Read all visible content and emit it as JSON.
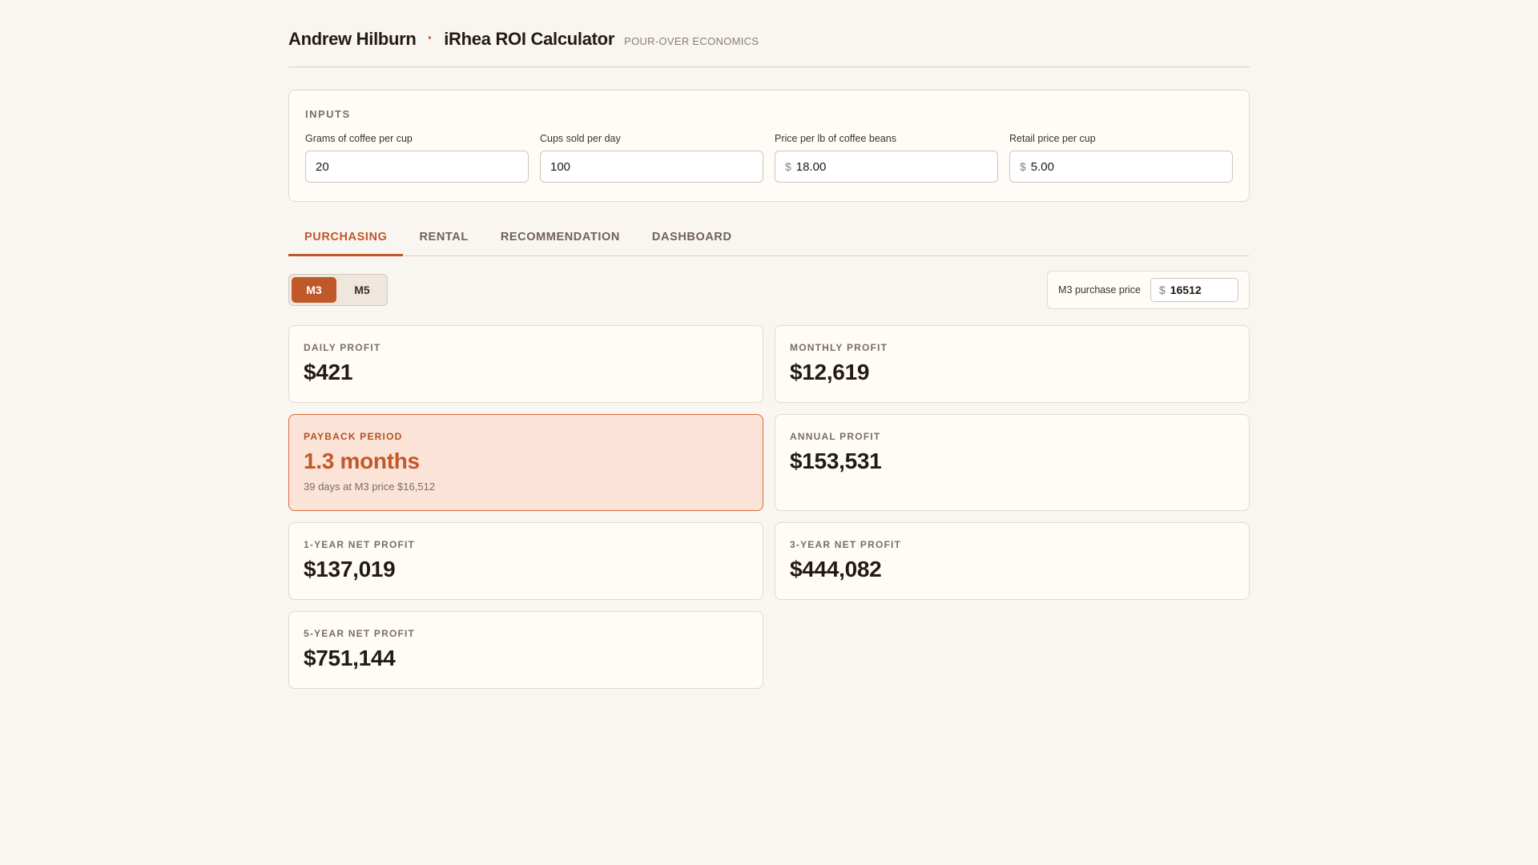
{
  "header": {
    "name": "Andrew Hilburn",
    "separator": "·",
    "title": "iRhea ROI Calculator",
    "tagline": "POUR-OVER ECONOMICS"
  },
  "inputs": {
    "section_label": "INPUTS",
    "fields": [
      {
        "label": "Grams of coffee per cup",
        "value": "20",
        "currency": ""
      },
      {
        "label": "Cups sold per day",
        "value": "100",
        "currency": ""
      },
      {
        "label": "Price per lb of coffee beans",
        "value": "18.00",
        "currency": "$"
      },
      {
        "label": "Retail price per cup",
        "value": "5.00",
        "currency": "$"
      }
    ]
  },
  "tabs": [
    {
      "label": "PURCHASING",
      "active": true
    },
    {
      "label": "RENTAL",
      "active": false
    },
    {
      "label": "RECOMMENDATION",
      "active": false
    },
    {
      "label": "DASHBOARD",
      "active": false
    }
  ],
  "model_toggle": {
    "options": [
      "M3",
      "M5"
    ],
    "selected": "M3"
  },
  "purchase_price": {
    "label": "M3 purchase price",
    "currency": "$",
    "value": "16512"
  },
  "cards": {
    "daily_profit": {
      "label": "DAILY PROFIT",
      "value": "$421"
    },
    "monthly_profit": {
      "label": "MONTHLY PROFIT",
      "value": "$12,619"
    },
    "payback_period": {
      "label": "PAYBACK PERIOD",
      "value": "1.3 months",
      "sub": "39 days at M3 price $16,512"
    },
    "annual_profit": {
      "label": "ANNUAL PROFIT",
      "value": "$153,531"
    },
    "net_1yr": {
      "label": "1-YEAR NET PROFIT",
      "value": "$137,019"
    },
    "net_3yr": {
      "label": "3-YEAR NET PROFIT",
      "value": "$444,082"
    },
    "net_5yr": {
      "label": "5-YEAR NET PROFIT",
      "value": "$751,144"
    }
  },
  "colors": {
    "accent": "#c0582a",
    "background": "#f9f5f0",
    "card": "#fffcf8",
    "highlight_card": "#fbe3d8"
  }
}
